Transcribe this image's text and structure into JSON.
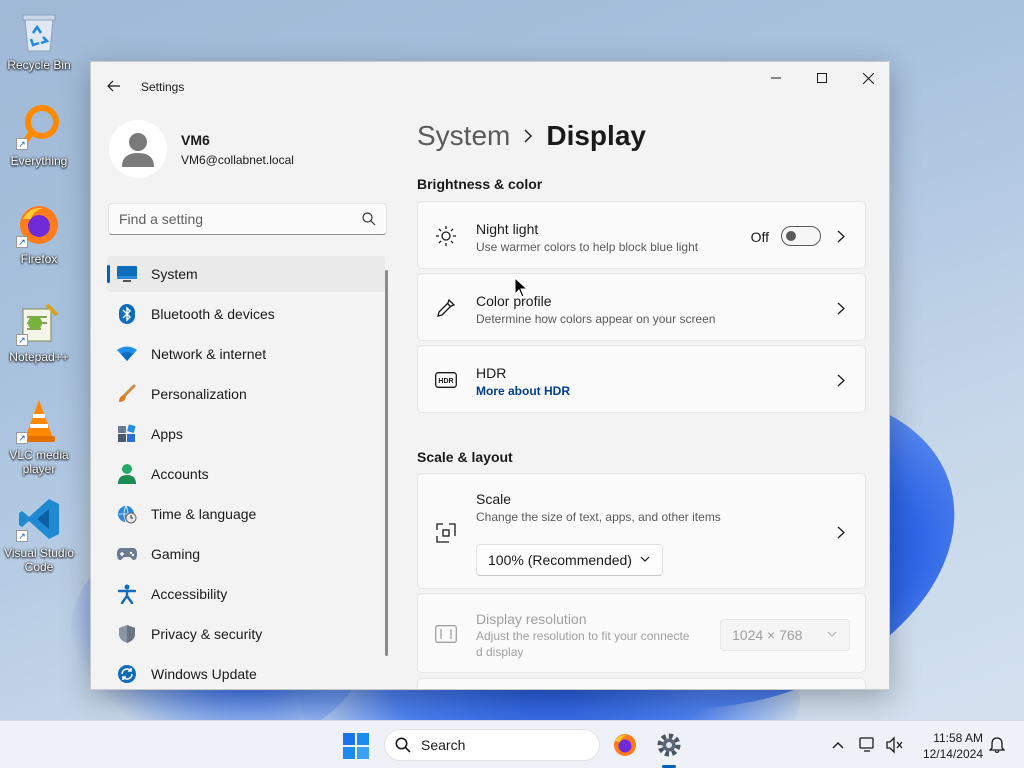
{
  "desktop": {
    "icons": [
      {
        "label": "Recycle Bin"
      },
      {
        "label": "Everything"
      },
      {
        "label": "Firefox"
      },
      {
        "label": "Notepad++"
      },
      {
        "label": "VLC media player"
      },
      {
        "label": "Visual Studio Code"
      }
    ]
  },
  "window": {
    "title": "Settings",
    "profile": {
      "name": "VM6",
      "email": "VM6@collabnet.local"
    },
    "search": {
      "placeholder": "Find a setting"
    },
    "nav": [
      {
        "label": "System",
        "icon": "monitor-icon",
        "active": true
      },
      {
        "label": "Bluetooth & devices",
        "icon": "bluetooth-icon"
      },
      {
        "label": "Network & internet",
        "icon": "wifi-icon"
      },
      {
        "label": "Personalization",
        "icon": "brush-icon"
      },
      {
        "label": "Apps",
        "icon": "apps-icon"
      },
      {
        "label": "Accounts",
        "icon": "person-icon"
      },
      {
        "label": "Time & language",
        "icon": "globe-clock-icon"
      },
      {
        "label": "Gaming",
        "icon": "gamepad-icon"
      },
      {
        "label": "Accessibility",
        "icon": "accessibility-icon"
      },
      {
        "label": "Privacy & security",
        "icon": "shield-icon"
      },
      {
        "label": "Windows Update",
        "icon": "update-icon"
      }
    ],
    "breadcrumb": {
      "parent": "System",
      "current": "Display"
    },
    "sections": {
      "brightness": "Brightness & color",
      "scale_layout": "Scale & layout"
    },
    "cards": {
      "night_light": {
        "title": "Night light",
        "subtitle": "Use warmer colors to help block blue light",
        "state": "Off",
        "on": false
      },
      "color_profile": {
        "title": "Color profile",
        "subtitle": "Determine how colors appear on your screen"
      },
      "hdr": {
        "title": "HDR",
        "link": "More about HDR"
      },
      "scale": {
        "title": "Scale",
        "subtitle": "Change the size of text, apps, and other items",
        "value": "100% (Recommended)"
      },
      "resolution": {
        "title": "Display resolution",
        "subtitle_line1": "Adjust the resolution to fit your connecte",
        "subtitle_line2": "d display",
        "value": "1024 × 768"
      }
    }
  },
  "taskbar": {
    "search_label": "Search",
    "time": "11:58 AM",
    "date": "12/14/2024"
  },
  "colors": {
    "accent": "#005fb8",
    "link": "#003e92"
  }
}
